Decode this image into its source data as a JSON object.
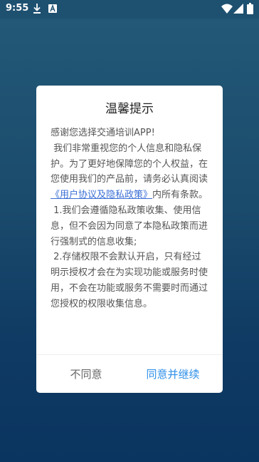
{
  "status_bar": {
    "time": "9:55",
    "icons": [
      "download-icon",
      "a-icon",
      "wifi-icon",
      "signal-icon",
      "battery-icon"
    ]
  },
  "dialog": {
    "title": "温馨提示",
    "body": {
      "greeting": "感谢您选择交通培训APP!",
      "para1_pre": "我们非常重视您的个人信息和隐私保护。为了更好地保障您的个人权益，在您使用我们的产品前，请务必认真阅读",
      "policy_link": "《用户协议及隐私政策》",
      "para1_post": "内所有条款。",
      "para2": "1.我们会遵循隐私政策收集、使用信息，但不会因为同意了本隐私政策而进行强制式的信息收集;",
      "para3": "2.存储权限不会默认开启，只有经过明示授权才会在为实现功能或服务时使用，不会在功能或服务不需要时而通过您授权的权限收集信息。"
    },
    "buttons": {
      "disagree": "不同意",
      "agree": "同意并继续"
    }
  },
  "colors": {
    "link": "#3b6fd6",
    "agree": "#2f8fe8",
    "background_top": "#245a78",
    "background_bottom": "#0a3560"
  }
}
